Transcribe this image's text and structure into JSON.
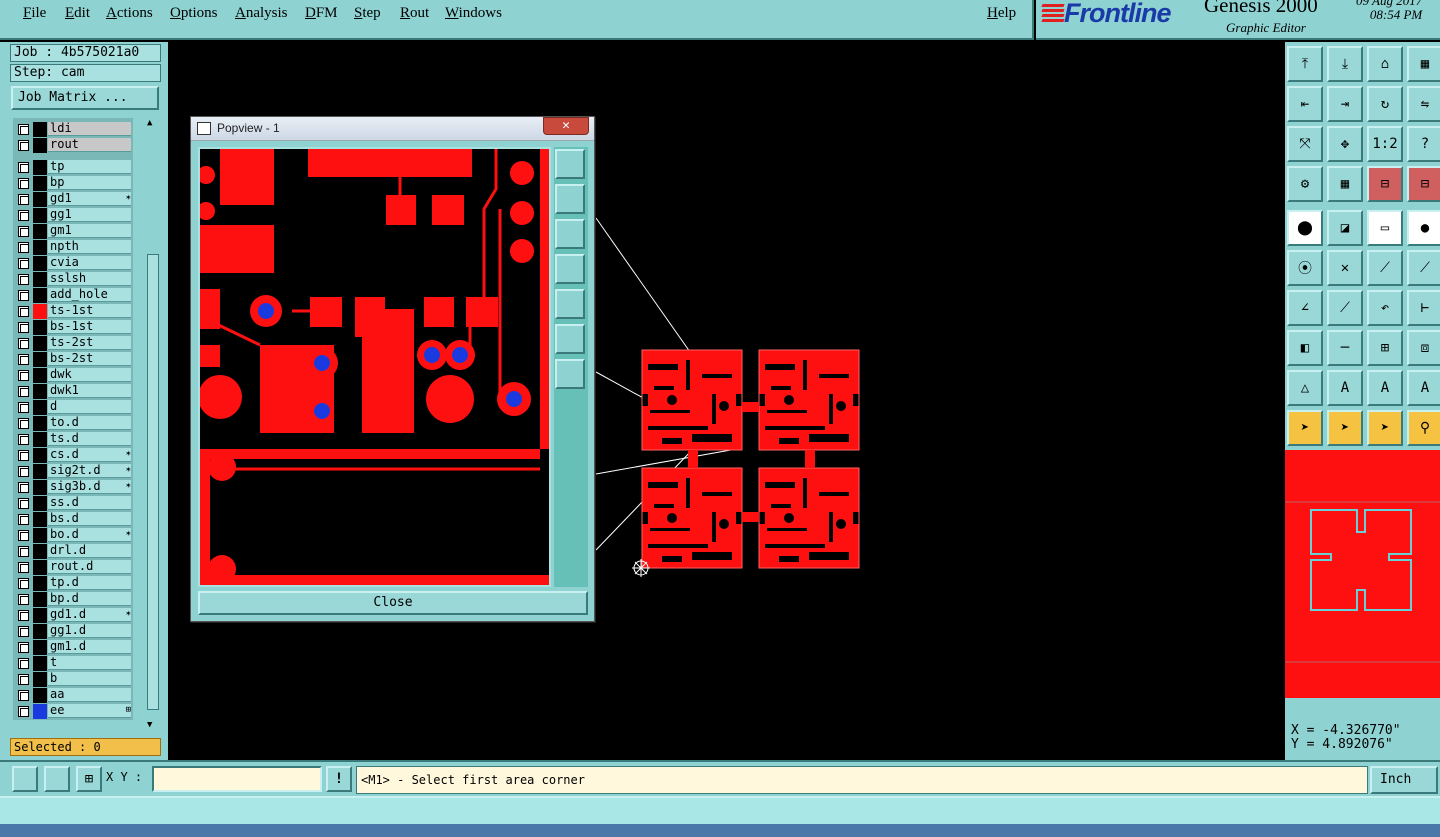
{
  "menu": {
    "file": "File",
    "edit": "Edit",
    "actions": "Actions",
    "options": "Options",
    "analysis": "Analysis",
    "dfm": "DFM",
    "step": "Step",
    "rout": "Rout",
    "windows": "Windows",
    "help": "Help"
  },
  "brand": {
    "logo": "Frontline",
    "product": "Genesis 2000",
    "subtitle": "Graphic Editor",
    "date": "09 Aug 2017",
    "time": "08:54 PM"
  },
  "job": {
    "job_label": "Job : 4b575021a0",
    "step_label": "Step: cam",
    "job_matrix_button": "Job Matrix ..."
  },
  "layers": [
    {
      "name": "ldi",
      "sel": true
    },
    {
      "name": "rout",
      "sel": true
    },
    {
      "name": "tp"
    },
    {
      "name": "bp"
    },
    {
      "name": "gd1",
      "flag": "✶"
    },
    {
      "name": "gg1"
    },
    {
      "name": "gm1"
    },
    {
      "name": "npth"
    },
    {
      "name": "cvia"
    },
    {
      "name": "sslsh"
    },
    {
      "name": "add_hole"
    },
    {
      "name": "ts-1st",
      "color": "#ff1010"
    },
    {
      "name": "bs-1st"
    },
    {
      "name": "ts-2st"
    },
    {
      "name": "bs-2st"
    },
    {
      "name": "dwk"
    },
    {
      "name": "dwk1"
    },
    {
      "name": "d"
    },
    {
      "name": "to.d"
    },
    {
      "name": "ts.d"
    },
    {
      "name": "cs.d",
      "flag": "✶"
    },
    {
      "name": "sig2t.d",
      "flag": "✶"
    },
    {
      "name": "sig3b.d",
      "flag": "✶"
    },
    {
      "name": "ss.d"
    },
    {
      "name": "bs.d"
    },
    {
      "name": "bo.d",
      "flag": "✶"
    },
    {
      "name": "drl.d"
    },
    {
      "name": "rout.d"
    },
    {
      "name": "tp.d"
    },
    {
      "name": "bp.d"
    },
    {
      "name": "gd1.d",
      "flag": "✶"
    },
    {
      "name": "gg1.d"
    },
    {
      "name": "gm1.d"
    },
    {
      "name": "t"
    },
    {
      "name": "b"
    },
    {
      "name": "aa"
    },
    {
      "name": "ee",
      "color": "#1a3ae0",
      "flag": "⊞"
    }
  ],
  "selected_label": "Selected : 0",
  "popview": {
    "title": "Popview - 1",
    "close_button": "Close",
    "close_x": "✕"
  },
  "coords": {
    "x": "X = -4.326770\"",
    "y": "Y = 4.892076\""
  },
  "command": {
    "xy_label": "X Y :",
    "input_value": "",
    "prompt": "<M1> - Select first area corner",
    "unit": "Inch"
  },
  "colors": {
    "ui_teal": "#8fd2d2",
    "copper_red": "#ff1010",
    "pad_blue": "#1a3ae0",
    "selected_yellow": "#f2c04a"
  }
}
